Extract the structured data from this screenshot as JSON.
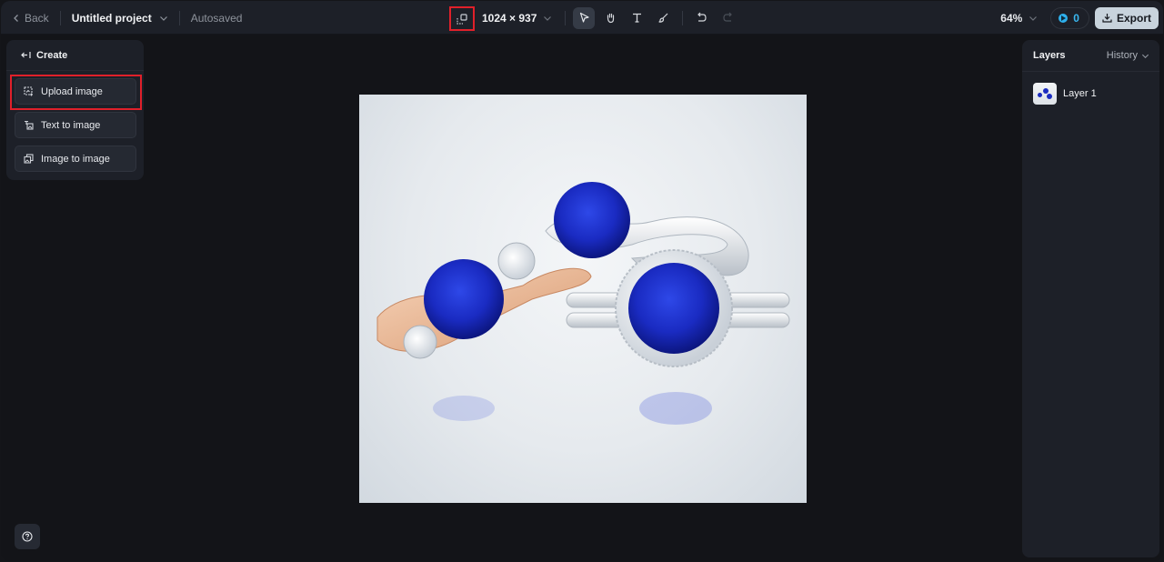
{
  "topbar": {
    "back_label": "Back",
    "project_title": "Untitled project",
    "save_status": "Autosaved",
    "canvas_size": "1024 × 937",
    "zoom_level": "64%",
    "credits": "0",
    "export_label": "Export",
    "tools": [
      {
        "name": "select",
        "icon": "cursor-arrow-icon",
        "active": true
      },
      {
        "name": "hand",
        "icon": "hand-icon",
        "active": false
      },
      {
        "name": "text",
        "icon": "text-icon",
        "active": false
      },
      {
        "name": "brush",
        "icon": "brush-icon",
        "active": false
      },
      {
        "name": "undo",
        "icon": "undo-icon",
        "active": false
      },
      {
        "name": "redo",
        "icon": "redo-icon",
        "active": false,
        "disabled": true
      }
    ]
  },
  "left_panel": {
    "header": "Create",
    "items": [
      {
        "label": "Upload image",
        "icon": "upload-image-icon",
        "highlighted": true
      },
      {
        "label": "Text to image",
        "icon": "text-to-image-icon"
      },
      {
        "label": "Image to image",
        "icon": "image-to-image-icon"
      }
    ]
  },
  "right_panel": {
    "title": "Layers",
    "history_label": "History",
    "layers": [
      {
        "name": "Layer 1"
      }
    ]
  },
  "canvas": {
    "image_description": "Three sapphire rings (rose gold three-stone, white gold bypass, white gold halo) on a light reflective background"
  },
  "colors": {
    "highlight": "#e0202a",
    "accent_credit": "#2eb0ec",
    "sapphire": "#1b2cc0"
  }
}
